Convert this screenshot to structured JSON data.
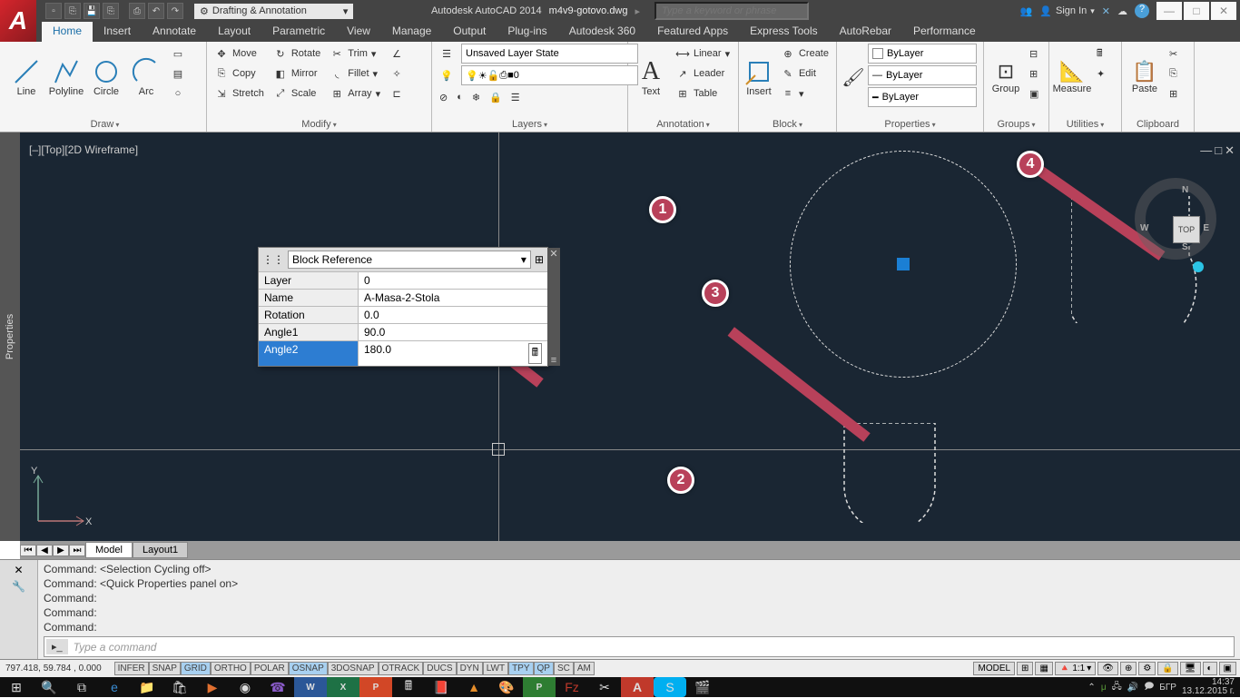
{
  "titlebar": {
    "workspace": "Drafting & Annotation",
    "app": "Autodesk AutoCAD 2014",
    "file": "m4v9-gotovo.dwg",
    "search_ph": "Type a keyword or phrase",
    "signin": "Sign In"
  },
  "tabs": [
    "Home",
    "Insert",
    "Annotate",
    "Layout",
    "Parametric",
    "View",
    "Manage",
    "Output",
    "Plug-ins",
    "Autodesk 360",
    "Featured Apps",
    "Express Tools",
    "AutoRebar",
    "Performance"
  ],
  "draw": {
    "line": "Line",
    "polyline": "Polyline",
    "circle": "Circle",
    "arc": "Arc",
    "title": "Draw"
  },
  "modify": {
    "move": "Move",
    "rotate": "Rotate",
    "trim": "Trim",
    "copy": "Copy",
    "mirror": "Mirror",
    "fillet": "Fillet",
    "stretch": "Stretch",
    "scale": "Scale",
    "array": "Array",
    "title": "Modify"
  },
  "layers": {
    "state": "Unsaved Layer State",
    "current": "0",
    "title": "Layers"
  },
  "annotation": {
    "text": "Text",
    "linear": "Linear",
    "leader": "Leader",
    "table": "Table",
    "title": "Annotation"
  },
  "block": {
    "insert": "Insert",
    "create": "Create",
    "edit": "Edit",
    "title": "Block"
  },
  "props": {
    "bylayer": "ByLayer",
    "match": "Match\nProperties",
    "title": "Properties"
  },
  "groups": {
    "group": "Group",
    "title": "Groups"
  },
  "util": {
    "measure": "Measure",
    "title": "Utilities"
  },
  "clip": {
    "paste": "Paste",
    "title": "Clipboard"
  },
  "viewport": {
    "label": "[–][Top][2D Wireframe]"
  },
  "quickprops": {
    "header": "Block Reference",
    "rows": [
      {
        "label": "Layer",
        "value": "0"
      },
      {
        "label": "Name",
        "value": "A-Masa-2-Stola"
      },
      {
        "label": "Rotation",
        "value": "0.0"
      },
      {
        "label": "Angle1",
        "value": "90.0"
      },
      {
        "label": "Angle2",
        "value": "180.0"
      }
    ]
  },
  "callouts": [
    "1",
    "2",
    "3",
    "4"
  ],
  "viewcube": {
    "face": "TOP",
    "n": "N",
    "s": "S",
    "e": "E",
    "w": "W"
  },
  "layout_tabs": {
    "model": "Model",
    "l1": "Layout1"
  },
  "cmd": {
    "l1": "Command:  <Selection Cycling off>",
    "l2": "Command: <Quick Properties panel on>",
    "l3": "Command:",
    "l4": "Command:",
    "l5": "Command:",
    "prompt": "Type a command",
    "icon": "▸_"
  },
  "status": {
    "coords": "797.418, 59.784 , 0.000",
    "toggles": [
      "INFER",
      "SNAP",
      "GRID",
      "ORTHO",
      "POLAR",
      "OSNAP",
      "3DOSNAP",
      "OTRACK",
      "DUCS",
      "DYN",
      "LWT",
      "TPY",
      "QP",
      "SC",
      "AM"
    ],
    "toggles_on": [
      2,
      5,
      11,
      12
    ],
    "model": "MODEL",
    "scale": "1:1"
  },
  "taskbar": {
    "time": "14:37",
    "date": "13.12.2015 г.",
    "lang": "БГР"
  },
  "properties_label": "Properties"
}
